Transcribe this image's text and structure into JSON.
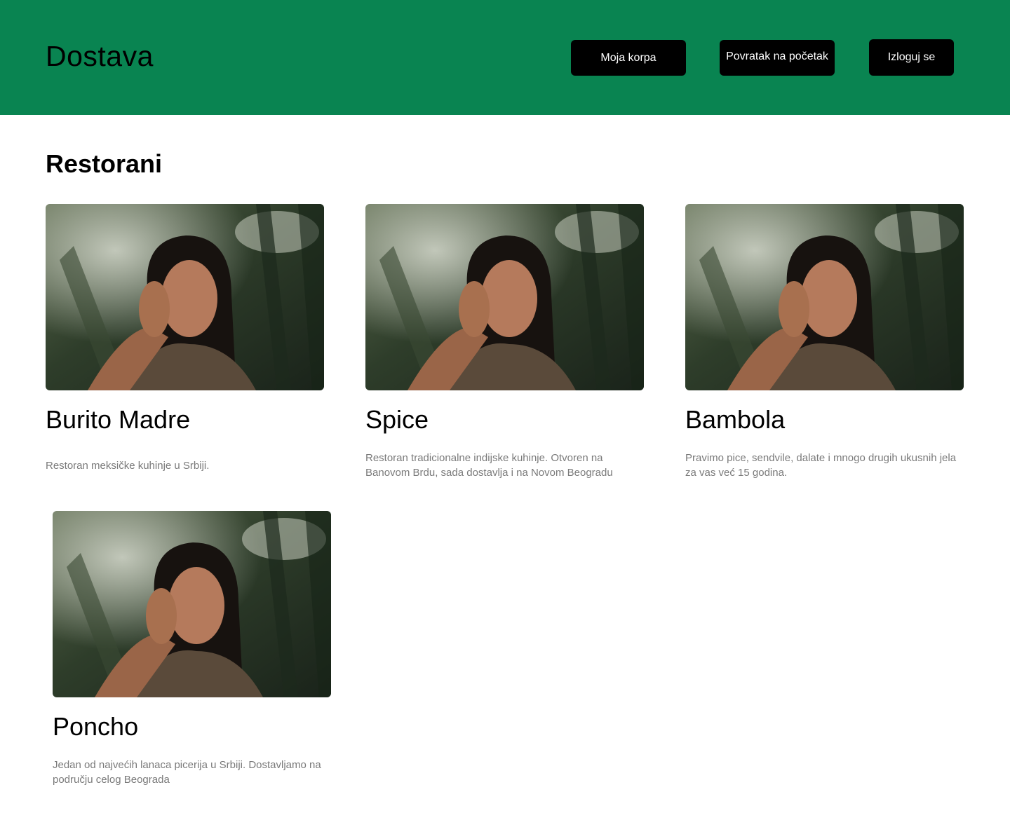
{
  "header": {
    "brand": "Dostava",
    "buttons": {
      "cart": "Moja korpa",
      "home": "Povratak na početak",
      "logout": "Izloguj se"
    }
  },
  "main": {
    "title": "Restorani",
    "restaurants": [
      {
        "name": "Burito Madre",
        "description": "Restoran meksičke kuhinje u Srbiji."
      },
      {
        "name": "Spice",
        "description": "Restoran tradicionalne indijske kuhinje. Otvoren na Banovom Brdu, sada dostavlja i na Novom Beogradu"
      },
      {
        "name": "Bambola",
        "description": "Pravimo pice, sendvile, dalate i mnogo drugih ukusnih jela za vas već 15 godina."
      },
      {
        "name": "Poncho",
        "description": "Jedan od najvećih lanaca picerija u Srbiji. Dostavljamo na području celog Beograda"
      }
    ]
  },
  "colors": {
    "header_bg": "#098451",
    "button_bg": "#000000",
    "description_text": "#7a7a7a"
  }
}
